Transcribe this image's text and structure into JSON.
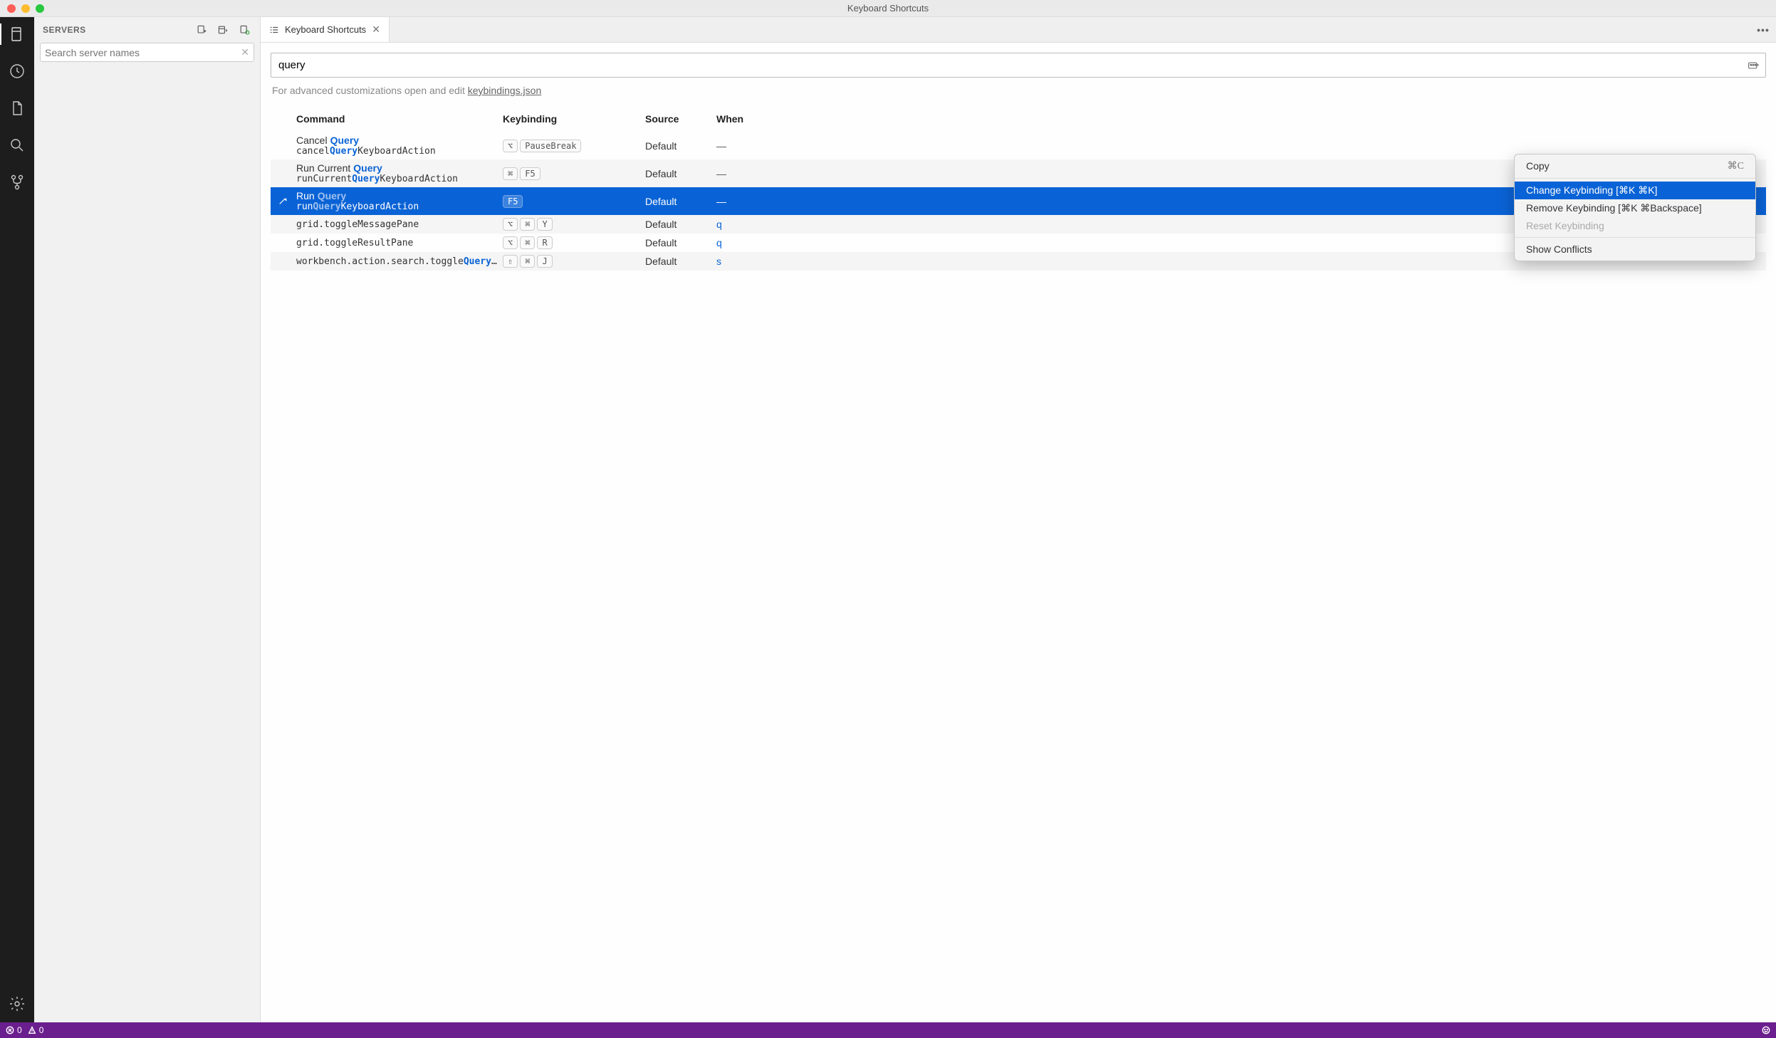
{
  "window": {
    "title": "Keyboard Shortcuts"
  },
  "sidebar": {
    "label": "SERVERS",
    "search_placeholder": "Search server names"
  },
  "tab": {
    "label": "Keyboard Shortcuts"
  },
  "overflow_menu": "•••",
  "search": {
    "value": "query"
  },
  "helper": {
    "text": "For advanced customizations open and edit ",
    "link": "keybindings.json"
  },
  "headers": {
    "command": "Command",
    "keybinding": "Keybinding",
    "source": "Source",
    "when": "When"
  },
  "rows": [
    {
      "title_pre": "Cancel ",
      "title_hl": "Query",
      "title_post": "",
      "id_pre": "cancel",
      "id_hl": "Query",
      "id_post": "KeyboardAction",
      "keys": [
        "⌥",
        "PauseBreak"
      ],
      "source": "Default",
      "when": "—"
    },
    {
      "title_pre": "Run Current ",
      "title_hl": "Query",
      "title_post": "",
      "id_pre": "runCurrent",
      "id_hl": "Query",
      "id_post": "KeyboardAction",
      "keys": [
        "⌘",
        "F5"
      ],
      "source": "Default",
      "when": "—"
    },
    {
      "title_pre": "Run ",
      "title_hl": "Query",
      "title_post": "",
      "id_pre": "run",
      "id_hl": "Query",
      "id_post": "KeyboardAction",
      "keys": [
        "F5"
      ],
      "source": "Default",
      "when": "—",
      "selected": true
    },
    {
      "id_plain": "grid.toggleMessagePane",
      "keys": [
        "⌥",
        "⌘",
        "Y"
      ],
      "source": "Default",
      "when": "q"
    },
    {
      "id_plain": "grid.toggleResultPane",
      "keys": [
        "⌥",
        "⌘",
        "R"
      ],
      "source": "Default",
      "when": "q"
    },
    {
      "id_pre": "workbench.action.search.toggle",
      "id_hl": "Query",
      "id_post": "…",
      "keys": [
        "⇧",
        "⌘",
        "J"
      ],
      "source": "Default",
      "when": "s"
    }
  ],
  "context_menu": {
    "copy": "Copy",
    "copy_sc": "⌘C",
    "change": "Change Keybinding [⌘K ⌘K]",
    "remove": "Remove Keybinding [⌘K ⌘Backspace]",
    "reset": "Reset Keybinding",
    "conflicts": "Show Conflicts"
  },
  "status": {
    "errors": "0",
    "warnings": "0"
  }
}
